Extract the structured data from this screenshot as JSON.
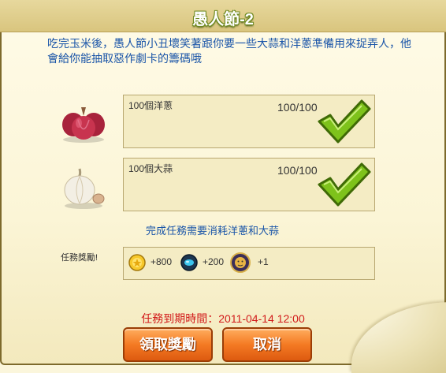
{
  "dialog": {
    "title": "愚人節-2",
    "description": "吃完玉米後，愚人節小丑壞笑著跟你要一些大蒜和洋蔥準備用來捉弄人，他會給你能抽取惡作劇卡的籌碼哦"
  },
  "tasks": [
    {
      "name": "100個洋蔥",
      "progress": "100/100",
      "icon": "onion-icon",
      "complete": true
    },
    {
      "name": "100個大蒜",
      "progress": "100/100",
      "icon": "garlic-icon",
      "complete": true
    }
  ],
  "note": "完成任務需要消耗洋蔥和大蒜",
  "rewards": {
    "label": "任務獎勵!",
    "items": [
      {
        "icon": "gold-coin-icon",
        "amount": "+800"
      },
      {
        "icon": "blue-gem-icon",
        "amount": "+200"
      },
      {
        "icon": "lion-badge-icon",
        "amount": "+1"
      }
    ]
  },
  "deadline": "任務到期時間：2011-04-14 12:00",
  "buttons": {
    "claim": "領取獎勵",
    "cancel": "取消"
  },
  "colors": {
    "title_stroke": "#6e8a21",
    "text_blue": "#1a55a8",
    "deadline_red": "#d21a1a",
    "button_orange": "#f47a23",
    "check_green": "#7ec21b"
  }
}
